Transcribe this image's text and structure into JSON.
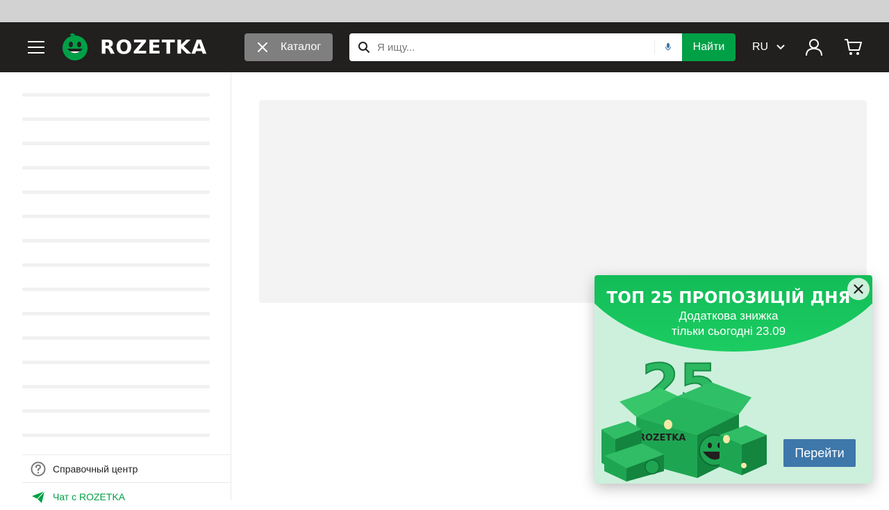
{
  "colors": {
    "header_bg": "#221f1f",
    "accent_green": "#00a046",
    "catalog_button_bg": "#7f7f7f",
    "promo_button": "#3e77aa"
  },
  "header": {
    "menu_icon": "hamburger-menu-icon",
    "logo_text": "ROZETKA",
    "catalog_label": "Каталог",
    "search_placeholder": "Я ищу...",
    "search_button": "Найти",
    "language": "RU",
    "icons": [
      "search-icon",
      "microphone-icon",
      "user-icon",
      "cart-icon"
    ]
  },
  "sidebar": {
    "help_center": "Справочный центр",
    "chat": "Чат с ROZETKA"
  },
  "promo": {
    "title": "ТОП 25 ПРОПОЗИЦІЙ ДНЯ",
    "subtitle_line1": "Додаткова знижка",
    "subtitle_line2": "тільки сьогодні 23.09",
    "art_number": "25",
    "box_brand": "ROZETKA",
    "button": "Перейти"
  }
}
